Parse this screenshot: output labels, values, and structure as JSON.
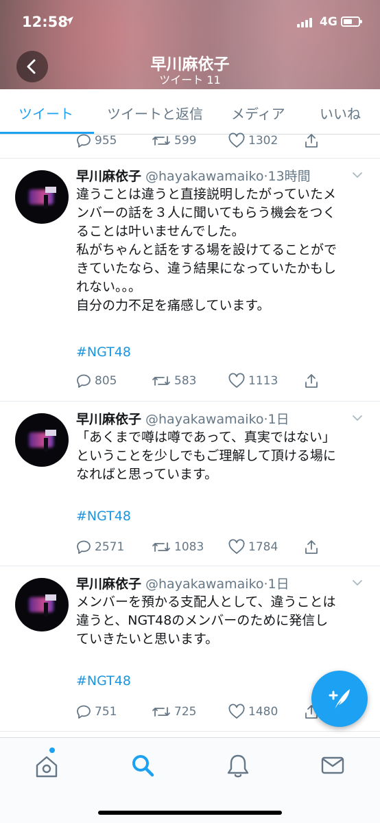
{
  "status_bar": {
    "time": "12:58",
    "network": "4G"
  },
  "header": {
    "name": "早川麻依子",
    "tweet_count": "ツイート 11"
  },
  "tabs": [
    {
      "label": "ツイート",
      "active": true
    },
    {
      "label": "ツイートと返信",
      "active": false
    },
    {
      "label": "メディア",
      "active": false
    },
    {
      "label": "いいね",
      "active": false
    }
  ],
  "partial_tweet": {
    "replies": "955",
    "retweets": "599",
    "likes": "1302"
  },
  "tweets": [
    {
      "name": "早川麻依子",
      "handle": "@hayakawamaiko",
      "time": "·13時間",
      "lines": [
        "違うことは違うと直接説明したがっていたメ",
        "ンバーの話を３人に聞いてもらう機会をつく",
        "ることは叶いませんでした。",
        "私がちゃんと話をする場を設けてることがで",
        "きていたなら、違う結果になっていたかもし",
        "れない。。。",
        "自分の力不足を痛感しています。"
      ],
      "hashtag": "#NGT48",
      "replies": "805",
      "retweets": "583",
      "likes": "1113"
    },
    {
      "name": "早川麻依子",
      "handle": "@hayakawamaiko",
      "time": "·1日",
      "lines": [
        "「あくまで噂は噂であって、真実ではない」",
        "ということを少しでもご理解して頂ける場に",
        "なればと思っています。"
      ],
      "hashtag": "#NGT48",
      "replies": "2571",
      "retweets": "1083",
      "likes": "1784"
    },
    {
      "name": "早川麻依子",
      "handle": "@hayakawamaiko",
      "time": "·1日",
      "lines": [
        "メンバーを預かる支配人として、違うことは",
        "違うと、NGT48のメンバーのために発信し",
        "ていきたいと思います。"
      ],
      "hashtag": "#NGT48",
      "replies": "751",
      "retweets": "725",
      "likes": "1480"
    }
  ],
  "colors": {
    "accent": "#1da1f2",
    "text": "#14171a",
    "muted": "#657786",
    "hashtag": "#1b95e0"
  },
  "icons": {
    "reply": "reply-icon",
    "retweet": "retweet-icon",
    "like": "heart-icon",
    "share": "share-icon",
    "home": "home-icon",
    "search": "search-icon",
    "notifications": "bell-icon",
    "messages": "envelope-icon",
    "compose": "compose-tweet-icon"
  }
}
